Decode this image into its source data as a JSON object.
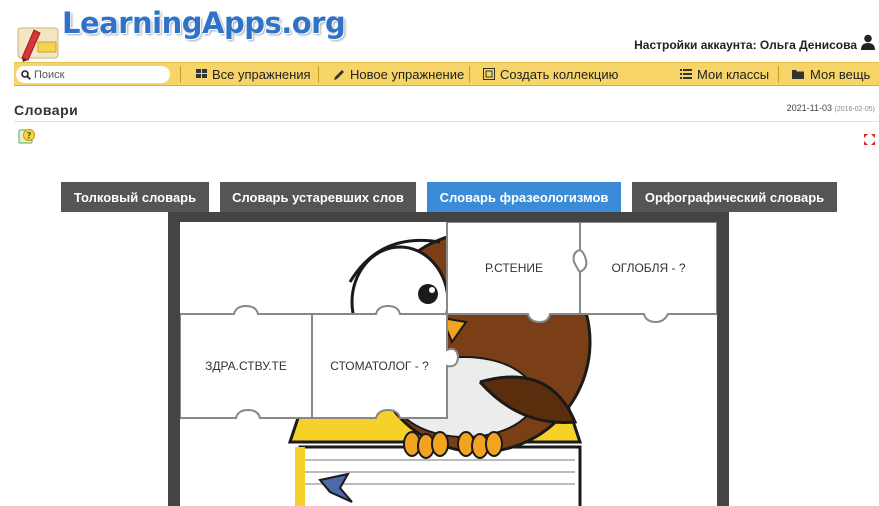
{
  "header": {
    "logo_text": "LearningApps.org",
    "account_label": "Настройки аккаунта: Ольга Денисова"
  },
  "toolbar": {
    "search_placeholder": "Поиск",
    "all_exercises": "Все упражнения",
    "new_exercise": "Новое упражнение",
    "create_collection": "Создать коллекцию",
    "my_classes": "Мои классы",
    "my_stuff": "Моя вещь"
  },
  "page": {
    "title": "Словари",
    "date": "2021-11-03",
    "date_created": "(2016-02-05)"
  },
  "tabs": [
    {
      "label": "Толковый словарь",
      "active": false
    },
    {
      "label": "Словарь устаревших слов",
      "active": false
    },
    {
      "label": "Словарь фразеологизмов",
      "active": true
    },
    {
      "label": "Орфографический словарь",
      "active": false
    }
  ],
  "puzzle": {
    "pieces": [
      {
        "text": "Р.СТЕНИЕ"
      },
      {
        "text": "ОГЛОБЛЯ - ?"
      },
      {
        "text": "ЗДРА.СТВУ.ТЕ"
      },
      {
        "text": "СТОМАТОЛОГ - ?"
      }
    ]
  },
  "colors": {
    "toolbar": "#f6d468",
    "tab_active": "#3b8cd8",
    "tab": "#555555",
    "logo": "#2f73c9",
    "frame": "#444444"
  }
}
